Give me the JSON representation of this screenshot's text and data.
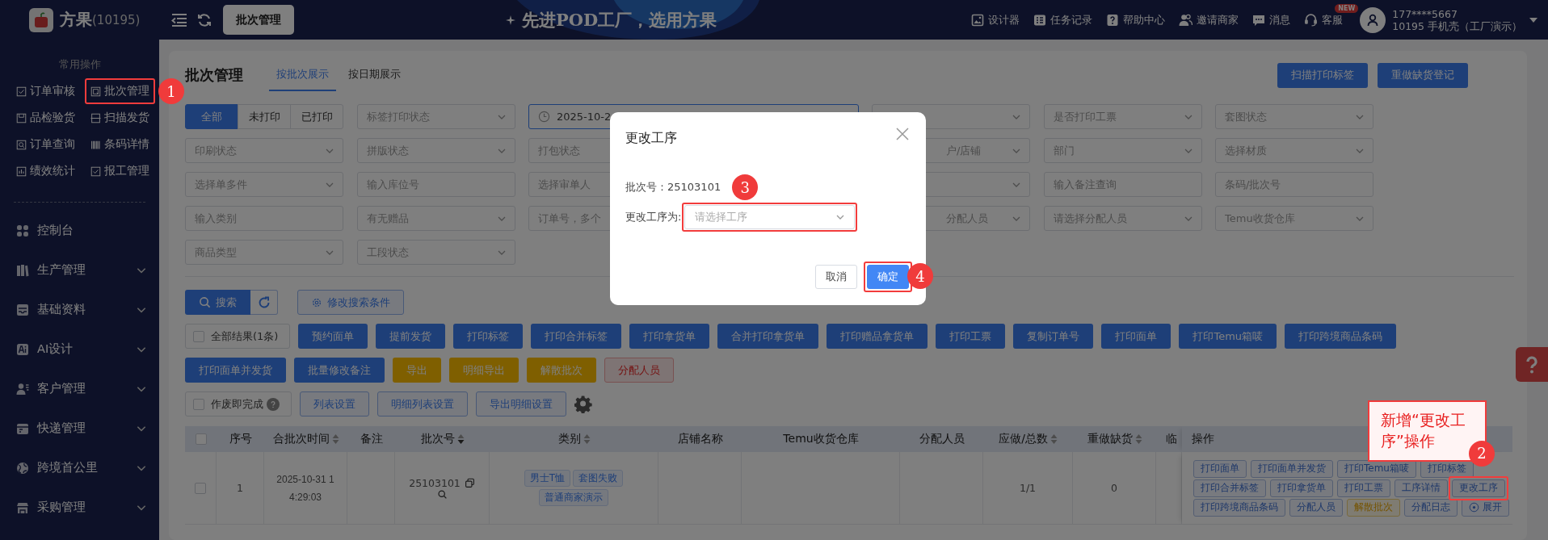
{
  "topbar": {
    "brand": "方果",
    "brand_code": "(10195)",
    "tab": "批次管理",
    "slogan": "先进POD工厂，选用方果",
    "links": [
      {
        "label": "设计器"
      },
      {
        "label": "任务记录"
      },
      {
        "label": "帮助中心"
      },
      {
        "label": "邀请商家"
      },
      {
        "label": "消息"
      },
      {
        "label": "客服",
        "badge": "NEW"
      }
    ],
    "user": {
      "phone": "177****5667",
      "org": "10195 手机壳（工厂演示）"
    }
  },
  "sidebar": {
    "title": "常用操作",
    "quick": [
      {
        "label": "订单审核"
      },
      {
        "label": "批次管理",
        "annotation": "1"
      },
      {
        "label": "品检验货"
      },
      {
        "label": "扫描发货"
      },
      {
        "label": "订单查询"
      },
      {
        "label": "条码详情"
      },
      {
        "label": "绩效统计"
      },
      {
        "label": "报工管理"
      }
    ],
    "menu": [
      {
        "label": "控制台",
        "expandable": false
      },
      {
        "label": "生产管理",
        "expandable": true
      },
      {
        "label": "基础资料",
        "expandable": true
      },
      {
        "label": "AI设计",
        "expandable": true
      },
      {
        "label": "客户管理",
        "expandable": true
      },
      {
        "label": "快递管理",
        "expandable": true
      },
      {
        "label": "跨境首公里",
        "expandable": true
      },
      {
        "label": "采购管理",
        "expandable": true
      }
    ]
  },
  "page": {
    "title": "批次管理",
    "tabs": [
      {
        "label": "按批次展示",
        "selected": true
      },
      {
        "label": "按日期展示",
        "selected": false
      }
    ],
    "actions": [
      "扫描打印标签",
      "重做缺货登记"
    ]
  },
  "filters": [
    [
      {
        "kind": "segments",
        "options": [
          {
            "label": "全部",
            "selected": true
          },
          {
            "label": "未打印",
            "selected": false
          },
          {
            "label": "已打印",
            "selected": false
          }
        ]
      },
      {
        "kind": "select",
        "placeholder": "标签打印状态"
      },
      {
        "kind": "date",
        "value": "2025-10-2"
      },
      {
        "kind": "select"
      },
      {
        "kind": "select",
        "placeholder": "是否打印工票"
      },
      {
        "kind": "select",
        "placeholder": "套图状态"
      }
    ],
    [
      {
        "kind": "select",
        "placeholder": "印刷状态"
      },
      {
        "kind": "select",
        "placeholder": "拼版状态"
      },
      {
        "kind": "input",
        "placeholder": "打包状态"
      },
      {
        "kind": "select",
        "placeholder": "户/店铺"
      },
      {
        "kind": "select",
        "placeholder": "部门"
      },
      {
        "kind": "select",
        "placeholder": "选择材质"
      }
    ],
    [
      {
        "kind": "select",
        "placeholder": "选择单多件"
      },
      {
        "kind": "input",
        "placeholder": "输入库位号"
      },
      {
        "kind": "select",
        "placeholder": "选择审单人"
      },
      {
        "kind": "select"
      },
      {
        "kind": "input",
        "placeholder": "输入备注查询"
      },
      {
        "kind": "input",
        "placeholder": "条码/批次号"
      }
    ],
    [
      {
        "kind": "input",
        "placeholder": "输入类别"
      },
      {
        "kind": "select",
        "placeholder": "有无赠品"
      },
      {
        "kind": "input",
        "placeholder": "订单号，多个"
      },
      {
        "kind": "select",
        "placeholder": "分配人员"
      },
      {
        "kind": "select",
        "placeholder": "请选择分配人员"
      },
      {
        "kind": "select",
        "placeholder": "Temu收货仓库"
      }
    ],
    [
      {
        "kind": "select",
        "placeholder": "商品类型"
      },
      {
        "kind": "select",
        "placeholder": "工段状态"
      }
    ]
  ],
  "search": {
    "button": "搜索",
    "modify": "修改搜索条件"
  },
  "actions": [
    [
      {
        "kind": "checkbox",
        "label": "全部结果(1条)",
        "checked": false,
        "help": false
      },
      {
        "kind": "primary",
        "label": "预约面单"
      },
      {
        "kind": "primary",
        "label": "提前发货"
      },
      {
        "kind": "primary",
        "label": "打印标签"
      },
      {
        "kind": "primary",
        "label": "打印合并标签"
      },
      {
        "kind": "primary",
        "label": "打印拿货单"
      },
      {
        "kind": "primary",
        "label": "合并打印拿货单"
      },
      {
        "kind": "primary",
        "label": "打印赠品拿货单"
      },
      {
        "kind": "primary",
        "label": "打印工票"
      },
      {
        "kind": "primary",
        "label": "复制订单号"
      },
      {
        "kind": "primary",
        "label": "打印面单"
      },
      {
        "kind": "primary",
        "label": "打印Temu箱唛"
      },
      {
        "kind": "primary",
        "label": "打印跨境商品条码"
      }
    ],
    [
      {
        "kind": "primary",
        "label": "打印面单并发货"
      },
      {
        "kind": "primary",
        "label": "批量修改备注"
      },
      {
        "kind": "warning",
        "label": "导出"
      },
      {
        "kind": "warning",
        "label": "明细导出"
      },
      {
        "kind": "warning",
        "label": "解散批次"
      },
      {
        "kind": "danger",
        "label": "分配人员"
      }
    ],
    [
      {
        "kind": "checkbox",
        "label": "作废即完成",
        "checked": false,
        "help": true
      },
      {
        "kind": "outline",
        "label": "列表设置"
      },
      {
        "kind": "outline",
        "label": "明细列表设置"
      },
      {
        "kind": "outline",
        "label": "导出明细设置"
      },
      {
        "kind": "gear"
      }
    ]
  ],
  "table": {
    "header_checked": false,
    "columns": [
      {
        "label": "序号",
        "sortable": false
      },
      {
        "label": "合批次时间",
        "sortable": true
      },
      {
        "label": "备注",
        "sortable": false
      },
      {
        "label": "批次号",
        "sortable": true
      },
      {
        "label": "类别",
        "sortable": true
      },
      {
        "label": "店铺名称",
        "sortable": false
      },
      {
        "label": "Temu收货仓库",
        "sortable": false
      },
      {
        "label": "分配人员",
        "sortable": false
      },
      {
        "label": "应做/总数",
        "sortable": true
      },
      {
        "label": "重做缺货",
        "sortable": true
      },
      {
        "label": "临",
        "sortable": false
      },
      {
        "label": "操作",
        "sortable": false
      }
    ],
    "rows": [
      {
        "checked": false,
        "index": "1",
        "time": "2025-10-31 14:29:03",
        "batch": "25103101",
        "tags": [
          "男士T恤",
          "套图失败",
          "普通商家演示"
        ],
        "done_total": "1/1",
        "redo": "0",
        "ops": [
          [
            {
              "label": "打印面单",
              "kind": "plain"
            },
            {
              "label": "打印面单并发货",
              "kind": "plain"
            },
            {
              "label": "打印Temu箱唛",
              "kind": "plain"
            },
            {
              "label": "打印标签",
              "kind": "plain"
            }
          ],
          [
            {
              "label": "打印合并标签",
              "kind": "plain"
            },
            {
              "label": "打印拿货单",
              "kind": "plain"
            },
            {
              "label": "打印工票",
              "kind": "plain"
            },
            {
              "label": "工序详情",
              "kind": "plain"
            },
            {
              "label": "更改工序",
              "kind": "plain",
              "annotation": "2",
              "note": "新增“更改工序”操作"
            }
          ],
          [
            {
              "label": "打印跨境商品条码",
              "kind": "plain"
            },
            {
              "label": "分配人员",
              "kind": "plain"
            },
            {
              "label": "解散批次",
              "kind": "warning"
            },
            {
              "label": "分配日志",
              "kind": "plain"
            },
            {
              "label": "展开",
              "kind": "expand"
            }
          ]
        ]
      }
    ]
  },
  "modal": {
    "title": "更改工序",
    "batch": {
      "label": "批次号：",
      "value": "25103101",
      "annotation": "3"
    },
    "field": {
      "label": "更改工序为:",
      "placeholder": "请选择工序",
      "highlighted": true
    },
    "buttons": [
      {
        "label": "取消",
        "kind": "default"
      },
      {
        "label": "确定",
        "kind": "primary",
        "annotation": "4"
      }
    ]
  }
}
